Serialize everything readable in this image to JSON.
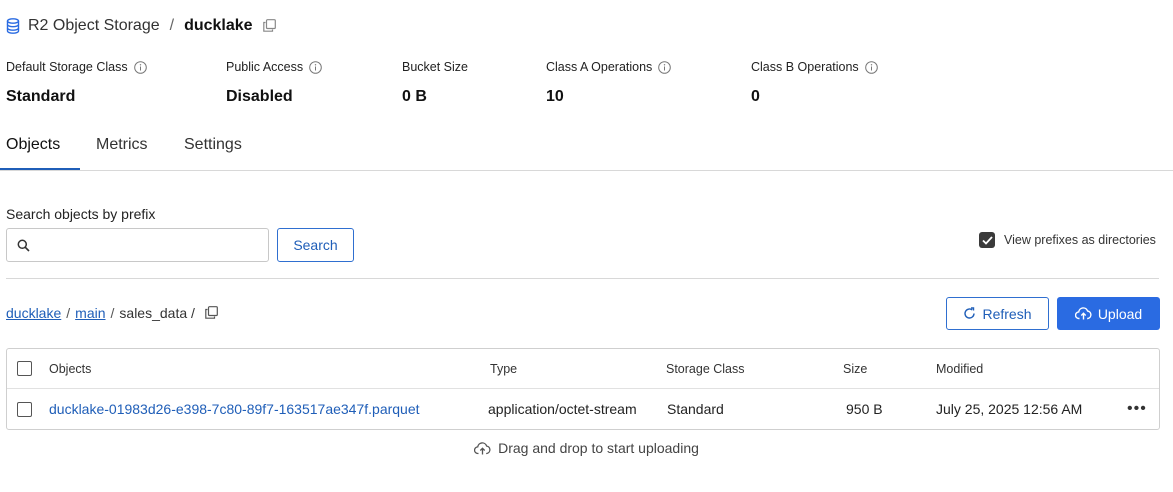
{
  "header": {
    "root": "R2 Object Storage",
    "separator": "/",
    "bucket": "ducklake"
  },
  "stats": [
    {
      "label": "Default Storage Class",
      "value": "Standard"
    },
    {
      "label": "Public Access",
      "value": "Disabled"
    },
    {
      "label": "Bucket Size",
      "value": "0 B"
    },
    {
      "label": "Class A Operations",
      "value": "10"
    },
    {
      "label": "Class B Operations",
      "value": "0"
    }
  ],
  "tabs": [
    {
      "label": "Objects",
      "active": true
    },
    {
      "label": "Metrics",
      "active": false
    },
    {
      "label": "Settings",
      "active": false
    }
  ],
  "search": {
    "label": "Search objects by prefix",
    "value": "",
    "placeholder": "",
    "button": "Search"
  },
  "prefix_toggle": {
    "label": "View prefixes as directories",
    "checked": true
  },
  "path": {
    "segments": [
      "ducklake",
      "main"
    ],
    "current": "sales_data /",
    "separator": "/"
  },
  "actions": {
    "refresh": "Refresh",
    "upload": "Upload"
  },
  "table": {
    "columns": [
      "Objects",
      "Type",
      "Storage Class",
      "Size",
      "Modified"
    ],
    "rows": [
      {
        "name": "ducklake-01983d26-e398-7c80-89f7-163517ae347f.parquet",
        "type": "application/octet-stream",
        "storage_class": "Standard",
        "size": "950 B",
        "modified": "July 25, 2025 12:56 AM",
        "menu": "•••"
      }
    ]
  },
  "dropzone": {
    "text": "Drag and drop to start uploading"
  },
  "colors": {
    "accent": "#2a6be2",
    "link": "#1f5eb8",
    "border": "#cfcfcf"
  }
}
